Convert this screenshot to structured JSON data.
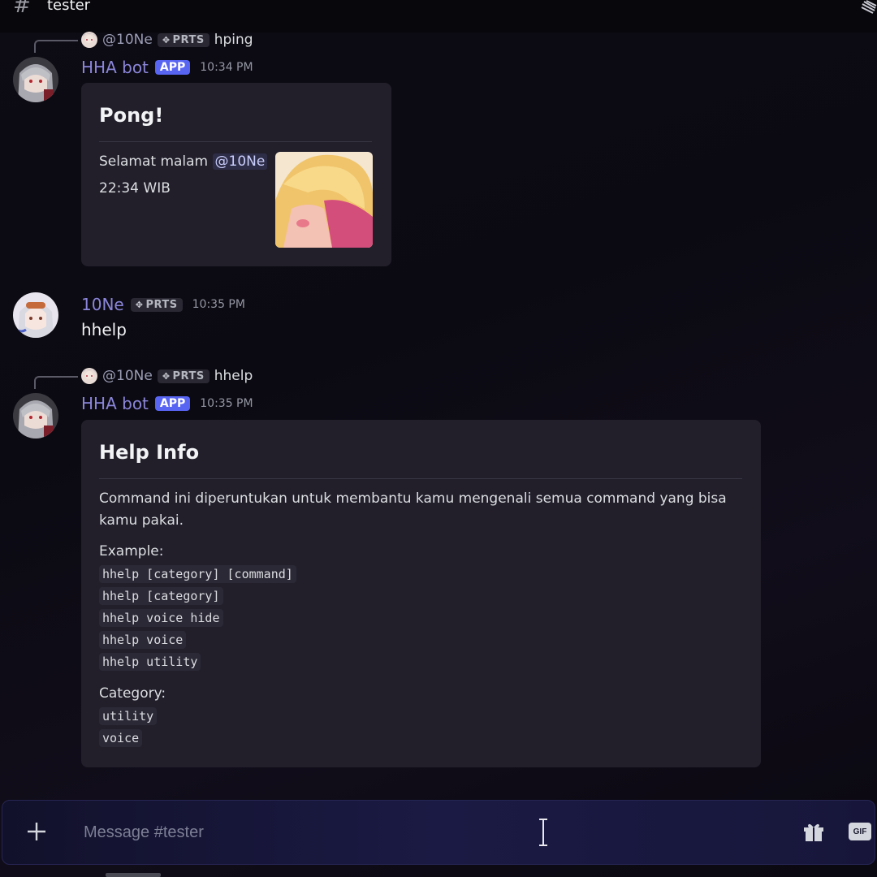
{
  "channel": {
    "name": "tester"
  },
  "messages": [
    {
      "reply": {
        "mention": "@10Ne",
        "tag": "PRTS",
        "text": "hping"
      },
      "author": "HHA bot",
      "badge": "APP",
      "time": "10:34 PM",
      "embed": {
        "title": "Pong!",
        "greeting": "Selamat malam",
        "mention": "@10Ne",
        "time_line": "22:34 WIB"
      }
    },
    {
      "author": "10Ne",
      "tag": "PRTS",
      "time": "10:35 PM",
      "content": "hhelp"
    },
    {
      "reply": {
        "mention": "@10Ne",
        "tag": "PRTS",
        "text": "hhelp"
      },
      "author": "HHA bot",
      "badge": "APP",
      "time": "10:35 PM",
      "embed": {
        "title": "Help Info",
        "description_line1": "Command ini diperuntukan untuk membantu kamu mengenali semua command yang bisa",
        "description_line2": "kamu pakai.",
        "example_label": "Example:",
        "examples": [
          "hhelp [category] [command]",
          "hhelp [category]",
          "hhelp voice hide",
          "hhelp voice",
          "hhelp utility"
        ],
        "category_label": "Category:",
        "categories": [
          "utility",
          "voice"
        ]
      }
    }
  ],
  "composer": {
    "placeholder": "Message #tester",
    "gif_label": "GIF"
  },
  "colors": {
    "accent": "#5865f2",
    "username": "#8b86d9",
    "embed_bg": "#221f2b"
  },
  "icons": [
    "hash-icon",
    "plus-icon",
    "gift-icon",
    "gif-icon",
    "text-cursor-icon"
  ]
}
